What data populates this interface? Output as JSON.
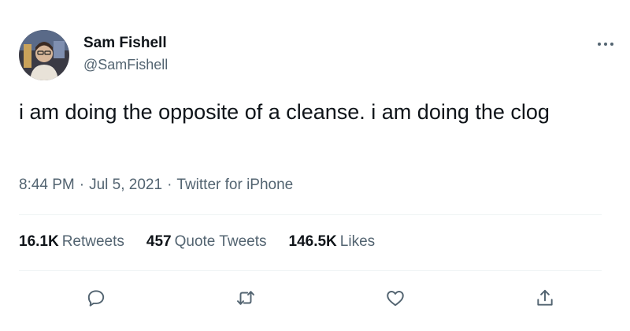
{
  "colors": {
    "primary_text": "#0f1419",
    "secondary_text": "#536471",
    "divider": "#eff3f4"
  },
  "author": {
    "name": "Sam Fishell",
    "handle": "@SamFishell",
    "avatar_icon": "user-avatar-photo"
  },
  "more_icon": "more-horizontal-icon",
  "tweet": {
    "text": "i am doing the opposite of a cleanse. i am doing the clog"
  },
  "meta": {
    "time": "8:44 PM",
    "separator": "·",
    "date": "Jul 5, 2021",
    "source": "Twitter for iPhone"
  },
  "stats": [
    {
      "count": "16.1K",
      "label": "Retweets"
    },
    {
      "count": "457",
      "label": "Quote Tweets"
    },
    {
      "count": "146.5K",
      "label": "Likes"
    }
  ],
  "actions": [
    {
      "icon": "reply-icon"
    },
    {
      "icon": "retweet-icon"
    },
    {
      "icon": "like-icon"
    },
    {
      "icon": "share-icon"
    }
  ]
}
